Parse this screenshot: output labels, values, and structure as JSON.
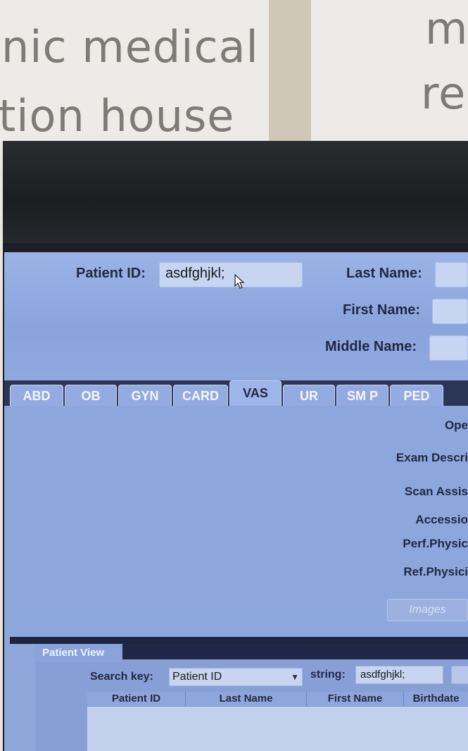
{
  "background_sign": {
    "left_line1": "nic medical",
    "left_line2": "tion house",
    "right_line1": "m",
    "right_line2": "re"
  },
  "header": {
    "patient_id_label": "Patient ID:",
    "patient_id_value": "asdfghjkl;",
    "last_name_label": "Last Name:",
    "last_name_value": "",
    "first_name_label": "First Name:",
    "first_name_value": "",
    "middle_name_label": "Middle Name:",
    "middle_name_value": ""
  },
  "tabs": [
    {
      "label": "ABD",
      "active": false
    },
    {
      "label": "OB",
      "active": false
    },
    {
      "label": "GYN",
      "active": false
    },
    {
      "label": "CARD",
      "active": false
    },
    {
      "label": "VAS",
      "active": true
    },
    {
      "label": "UR",
      "active": false
    },
    {
      "label": "SM P",
      "active": false
    },
    {
      "label": "PED",
      "active": false
    }
  ],
  "exam_fields": {
    "operator_label": "Ope",
    "exam_description_label": "Exam Descri",
    "scan_assistant_label": "Scan Assis",
    "accession_label": "Accessio",
    "perf_physician_label": "Perf.Physic",
    "ref_physician_label": "Ref.Physici",
    "images_button": "Images"
  },
  "patient_view": {
    "tab_label": "Patient View",
    "search_key_label": "Search key:",
    "search_key_value": "Patient ID",
    "string_label": "string:",
    "string_value": "asdfghjkl;",
    "columns": [
      "Patient ID",
      "Last Name",
      "First Name",
      "Birthdate"
    ]
  },
  "colors": {
    "screen_blue": "#8ea6da",
    "bezel": "#1d1f24",
    "label_text": "#1f2844"
  }
}
